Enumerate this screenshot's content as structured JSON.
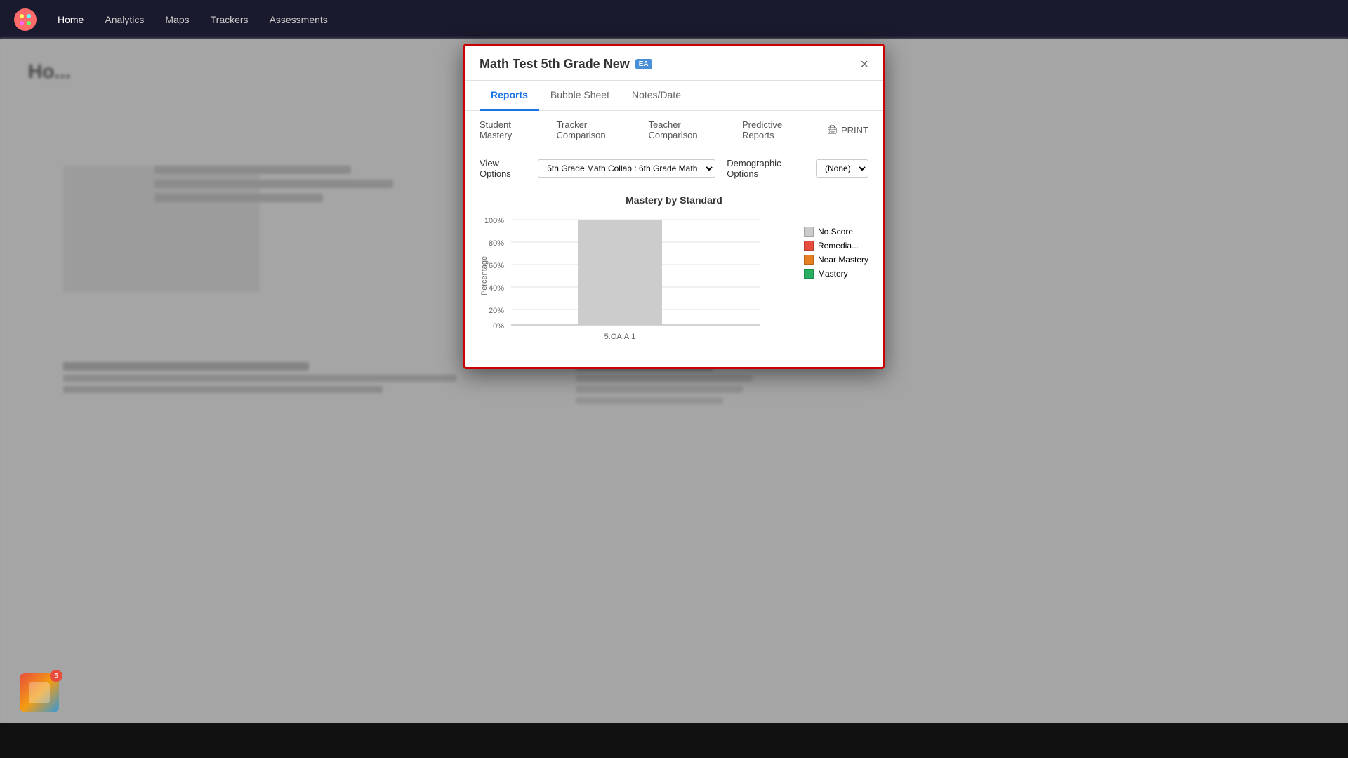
{
  "app": {
    "title": "Math Test 5th Grade New",
    "badge": "EA"
  },
  "nav": {
    "items": [
      "Home",
      "Analytics",
      "Maps",
      "Trackers",
      "Assessments"
    ]
  },
  "modal": {
    "title": "Math Test 5th Grade New",
    "badge_label": "EA",
    "close_label": "×",
    "tabs": [
      {
        "id": "reports",
        "label": "Reports",
        "active": true
      },
      {
        "id": "bubble-sheet",
        "label": "Bubble Sheet",
        "active": false
      },
      {
        "id": "notes-date",
        "label": "Notes/Date",
        "active": false
      }
    ],
    "sub_tabs": [
      {
        "id": "student-mastery",
        "label": "Student Mastery",
        "active": false
      },
      {
        "id": "tracker-comparison",
        "label": "Tracker Comparison",
        "active": false
      },
      {
        "id": "teacher-comparison",
        "label": "Teacher Comparison",
        "active": false
      },
      {
        "id": "predictive-reports",
        "label": "Predictive Reports",
        "active": false
      }
    ],
    "print_label": "PRINT",
    "options": {
      "view_options_label": "View Options",
      "view_options_value": "5th Grade Math Collab : 6th Grade Math",
      "demographic_options_label": "Demographic Options",
      "demographic_options_value": "(None)"
    },
    "chart": {
      "title": "Mastery by Standard",
      "y_labels": [
        "100%",
        "80%",
        "60%",
        "40%",
        "20%",
        "0%"
      ],
      "x_labels": [
        "5.OA.A.1"
      ],
      "legend": [
        {
          "label": "No Score",
          "color": "#cccccc"
        },
        {
          "label": "Remedia...",
          "color": "#e74c3c"
        },
        {
          "label": "Near Mastery",
          "color": "#e67e22"
        },
        {
          "label": "Mastery",
          "color": "#27ae60"
        }
      ],
      "bars": [
        {
          "standard": "5.OA.A.1",
          "no_score": 100,
          "remediation": 0,
          "near_mastery": 0,
          "mastery": 0
        }
      ]
    }
  },
  "background": {
    "home_title": "Ho...",
    "widget_count": "5"
  }
}
